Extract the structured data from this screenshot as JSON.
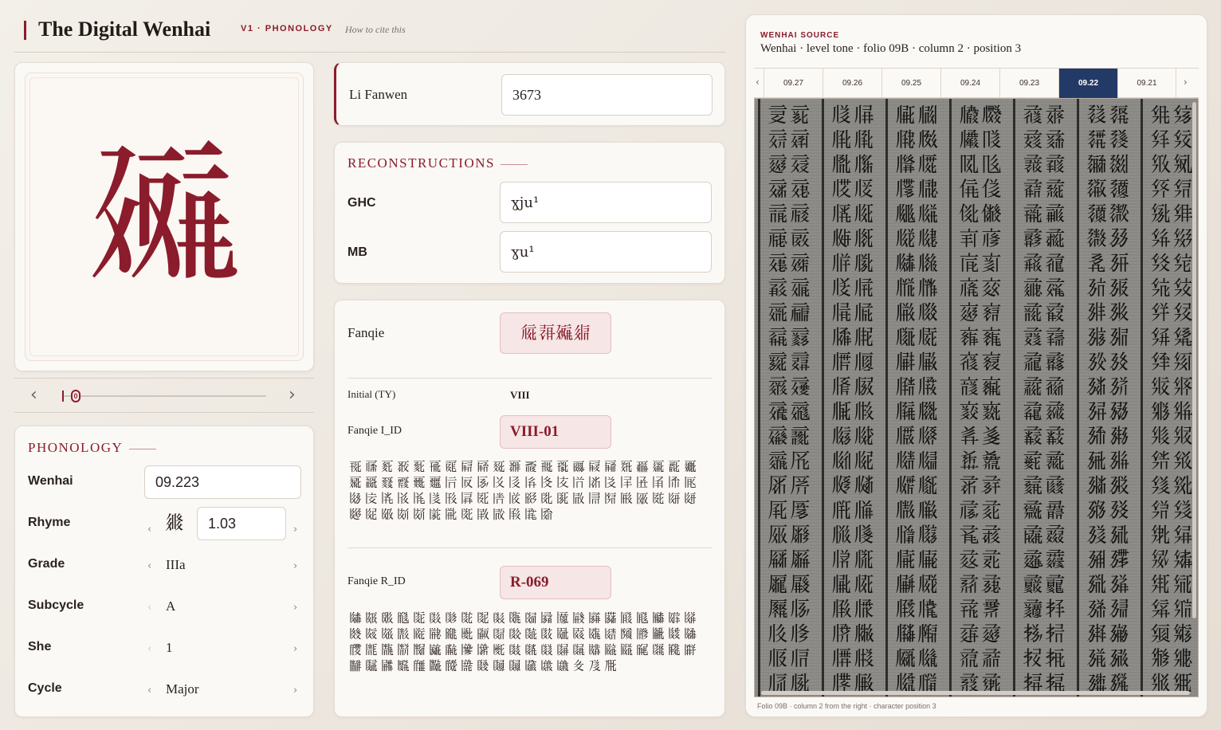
{
  "header": {
    "title": "The Digital Wenhai",
    "version": "V1 · PHONOLOGY",
    "cite": "How to cite this"
  },
  "glyph": {
    "char": "𗘁"
  },
  "slider": {
    "prev": "‹",
    "next": "›",
    "thumb_label": "0"
  },
  "phonology": {
    "title": "PHONOLOGY",
    "rows": {
      "wenhai": {
        "label": "Wenhai",
        "value": "09.223"
      },
      "rhyme": {
        "label": "Rhyme",
        "char": "𗦫",
        "value": "1.03"
      },
      "grade": {
        "label": "Grade",
        "value": "IIIa"
      },
      "subcycle": {
        "label": "Subcycle",
        "value": "A"
      },
      "she": {
        "label": "She",
        "value": "1"
      },
      "cycle": {
        "label": "Cycle",
        "value": "Major"
      }
    },
    "chev_left": "‹",
    "chev_right": "›"
  },
  "li_fanwen": {
    "label": "Li Fanwen",
    "value": "3673"
  },
  "reconstructions": {
    "title": "RECONSTRUCTIONS",
    "ghc": {
      "label": "GHC",
      "value": "ɣju¹"
    },
    "mb": {
      "label": "MB",
      "value": "ɣu¹"
    }
  },
  "fanqie": {
    "label": "Fanqie",
    "chars": "𗏁𗖊𗘁𗤋",
    "initial_label": "Initial (TY)",
    "initial_value": "VIII",
    "i_id_label": "Fanqie I_ID",
    "i_id_value": "VIII-01",
    "i_chars": "𗀔𗀕𗀖𗀗𗀘𗀙𗀚𗀛𗀜𗀝𗀞𗀟𗀠𗀡𗀢𗀣𗀤𗀥𗀦𗀧𗀨𗀩𗀪𗀫𗀬𗀭𗀮𗀯𗀰𗀱𗀲𗀳𗀴𗀵𗀶𗀷𗀸𗀹𗀺𗀻𗀼𗀽𗀾𗀿𗁀𗁁𗁂𗁃𗁄𗁅𗁆𗁇𗁈𗁉𗁊𗁋𗁌𗁍𗁎𗁏𗁐𗁑𗁒𗁓𗁔𗁕𗁖𗁗𗁘𗁙𗁚𗁛𗁜𗁝𗁞𗁟𗁠𗁡𗁢",
    "r_id_label": "Fanqie R_ID",
    "r_id_value": "R-069",
    "r_chars": "𗂀𗂁𗂂𗂃𗂄𗂅𗂆𗂇𗂈𗂉𗂊𗂋𗂌𗂍𗂎𗂏𗂐𗂑𗂒𗂓𗂔𗂕𗂖𗂗𗂘𗂙𗂚𗂛𗂜𗂝𗂞𗂟𗂠𗂡𗂢𗂣𗂤𗂥𗂦𗂧𗂨𗂩𗂪𗂫𗂬𗂭𗂮𗂯𗂰𗂱𗂲𗂳𗂴𗂵𗂶𗂷𗂸𗂹𗂺𗂻𗂼𗂽𗂾𗂿𗃀𗃁𗃂𗃃𗃄𗃅𗃆𗃇𗃈𗃉𗃊𗃋𗃌𗃍𗃎𗃏𗃐𗃑𗃒"
  },
  "source": {
    "kicker": "WENHAI SOURCE",
    "title": "Wenhai · level tone · folio 09B · column 2 · position 3",
    "tabs": [
      "09.27",
      "09.26",
      "09.25",
      "09.24",
      "09.23",
      "09.22",
      "09.21"
    ],
    "active_tab": "09.22",
    "prev": "‹",
    "next": "›",
    "caption": "Folio 09B · column 2 from the right · character position 3",
    "scan_columns": [
      "𗄀𗄁𗄂𗄃𗄄𗄅𗄆𗄇𗄈𗄉𗄊𗄋𗄌𗄍𗄎𗄏𗄐𗄑𗄒𗄓𗄔𗄕𗄖𗄗𗄘𗄙𗄚𗄛𗄜𗄝𗄞𗄟𗄠𗄡𗄢𗄣𗄤𗄥𗄦𗄧𗄨𗄩𗄪𗄫𗄬𗄭𗄮𗄯",
      "𗅀𗅁𗅂𗅃𗅄𗅅𗅆𗅇𗅈𗅉𗅊𗅋𗅌𗅍𗅎𗅏𗅐𗅑𗅒𗅓𗅔𗅕𗅖𗅗𗅘𗅙𗅚𗅛𗅜𗅝𗅞𗅟𗅠𗅡𗅢𗅣𗅤𗅥𗅦𗅧𗅨𗅩𗅪𗅫𗅬𗅭𗅮𗅯",
      "𗆀𗆁𗆂𗆃𗆄𗆅𗆆𗆇𗆈𗆉𗆊𗆋𗆌𗆍𗆎𗆏𗆐𗆑𗆒𗆓𗆔𗆕𗆖𗆗𗆘𗆙𗆚𗆛𗆜𗆝𗆞𗆟𗆠𗆡𗆢𗆣𗆤𗆥𗆦𗆧𗆨𗆩𗆪𗆫𗆬𗆭𗆮𗆯",
      "𗇀𗇁𗇂𗇃𗇄𗇅𗇆𗇇𗇈𗇉𗇊𗇋𗇌𗇍𗇎𗇏𗇐𗇑𗇒𗇓𗇔𗇕𗇖𗇗𗇘𗇙𗇚𗇛𗇜𗇝𗇞𗇟𗇠𗇡𗇢𗇣𗇤𗇥𗇦𗇧𗇨𗇩𗇪𗇫𗇬𗇭𗇮𗇯",
      "𗈀𗈁𗈂𗈃𗈄𗈅𗈆𗈇𗈈𗈉𗈊𗈋𗈌𗈍𗈎𗈏𗈐𗈑𗈒𗈓𗈔𗈕𗈖𗈗𗈘𗈙𗈚𗈛𗈜𗈝𗈞𗈟𗈠𗈡𗈢𗈣𗈤𗈥𗈦𗈧𗈨𗈩𗈪𗈫𗈬𗈭𗈮𗈯",
      "𗉀𗉁𗉂𗉃𗉄𗉅𗉆𗉇𗉈𗉉𗉊𗉋𗉌𗉍𗉎𗉏𗉐𗉑𗉒𗉓𗉔𗉕𗉖𗉗𗉘𗉙𗉚𗉛𗉜𗉝𗉞𗉟𗉠𗉡𗉢𗉣𗉤𗉥𗉦𗉧𗉨𗉩𗉪𗉫𗉬𗉭𗉮𗉯",
      "𗊀𗊁𗊂𗊃𗊄𗊅𗊆𗊇𗊈𗊉𗊊𗊋𗊌𗊍𗊎𗊏𗊐𗊑𗊒𗊓𗊔𗊕𗊖𗊗𗊘𗊙𗊚𗊛𗊜𗊝𗊞𗊟𗊠𗊡𗊢𗊣𗊤𗊥𗊦𗊧𗊨𗊩𗊪𗊫𗊬𗊭𗊮𗊯"
    ]
  },
  "colors": {
    "accent": "#8a1c2b",
    "tab_active": "#243a66",
    "background": "#efe9e2"
  }
}
